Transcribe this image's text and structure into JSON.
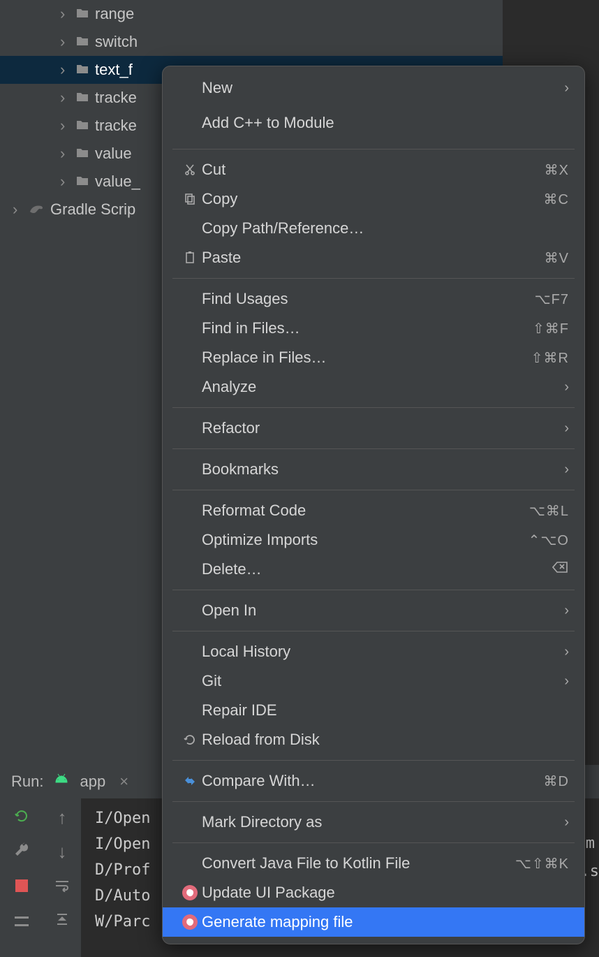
{
  "tree": {
    "items": [
      {
        "label": "range"
      },
      {
        "label": "switch"
      },
      {
        "label": "text_f"
      },
      {
        "label": "tracke"
      },
      {
        "label": "tracke"
      },
      {
        "label": "value"
      },
      {
        "label": "value_"
      }
    ],
    "root": {
      "label": "Gradle Scrip"
    }
  },
  "run": {
    "label": "Run:",
    "tab": "app"
  },
  "console": {
    "lines": [
      "I/Open",
      "I/Open",
      "D/Prof",
      "D/Auto",
      "W/Parc"
    ],
    "right_fragments": [
      "m",
      ".s"
    ]
  },
  "context_menu": {
    "groups": [
      [
        {
          "label": "New",
          "arrow": true
        },
        {
          "label": "Add C++ to Module"
        }
      ],
      [
        {
          "icon": "cut",
          "label": "Cut",
          "shortcut": "⌘X"
        },
        {
          "icon": "copy",
          "label": "Copy",
          "shortcut": "⌘C"
        },
        {
          "label": "Copy Path/Reference…"
        },
        {
          "icon": "paste",
          "label": "Paste",
          "shortcut": "⌘V"
        }
      ],
      [
        {
          "label": "Find Usages",
          "shortcut": "⌥F7"
        },
        {
          "label": "Find in Files…",
          "shortcut": "⇧⌘F"
        },
        {
          "label": "Replace in Files…",
          "shortcut": "⇧⌘R"
        },
        {
          "label": "Analyze",
          "arrow": true
        }
      ],
      [
        {
          "label": "Refactor",
          "arrow": true
        }
      ],
      [
        {
          "label": "Bookmarks",
          "arrow": true
        }
      ],
      [
        {
          "label": "Reformat Code",
          "shortcut": "⌥⌘L"
        },
        {
          "label": "Optimize Imports",
          "shortcut": "⌃⌥O"
        },
        {
          "label": "Delete…",
          "shortcut_icon": "delete"
        }
      ],
      [
        {
          "label": "Open In",
          "arrow": true
        }
      ],
      [
        {
          "label": "Local History",
          "arrow": true
        },
        {
          "label": "Git",
          "arrow": true
        },
        {
          "label": "Repair IDE"
        },
        {
          "icon": "reload",
          "label": "Reload from Disk"
        }
      ],
      [
        {
          "icon": "compare",
          "label": "Compare With…",
          "shortcut": "⌘D"
        }
      ],
      [
        {
          "label": "Mark Directory as",
          "arrow": true
        }
      ],
      [
        {
          "label": "Convert Java File to Kotlin File",
          "shortcut": "⌥⇧⌘K"
        },
        {
          "icon": "pink",
          "label": "Update UI Package"
        },
        {
          "icon": "pink",
          "label": "Generate mapping file",
          "selected": true
        }
      ]
    ]
  }
}
